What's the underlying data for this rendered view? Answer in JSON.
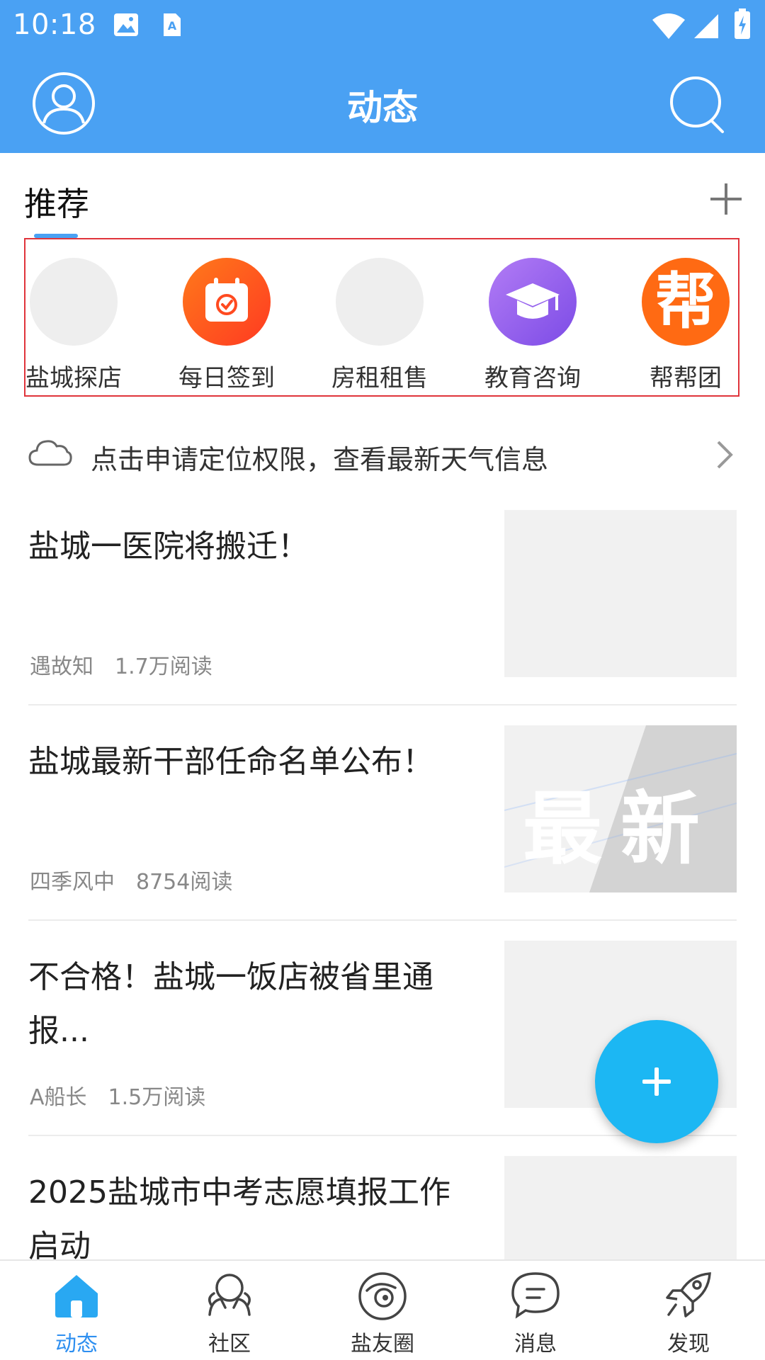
{
  "status_bar": {
    "time": "10:18"
  },
  "app_bar": {
    "title": "动态"
  },
  "tabs": {
    "active_tab": "推荐"
  },
  "recommend": [
    {
      "label": "盐城探店",
      "icon": "placeholder-icon"
    },
    {
      "label": "每日签到",
      "icon": "calendar-check-icon",
      "color": "#ff5a1f"
    },
    {
      "label": "房租租售",
      "icon": "placeholder-icon"
    },
    {
      "label": "教育咨询",
      "icon": "graduation-cap-icon",
      "color": "#9a5cf0"
    },
    {
      "label": "帮帮团",
      "icon": "bang-icon",
      "icon_text": "帮",
      "color": "#ff6a13"
    }
  ],
  "weather": {
    "text": "点击申请定位权限，查看最新天气信息"
  },
  "news": [
    {
      "title": "盐城一医院将搬迁！",
      "author": "遇故知",
      "reads": "1.7万阅读"
    },
    {
      "title": "盐城最新干部任命名单公布！",
      "author": "四季风中",
      "reads": "8754阅读",
      "thumb_text": "最新"
    },
    {
      "title": "不合格！盐城一饭店被省里通报...",
      "author": "A船长",
      "reads": "1.5万阅读"
    },
    {
      "title": "2025盐城市中考志愿填报工作启动"
    }
  ],
  "bottom_nav": [
    {
      "label": "动态",
      "icon": "home-icon",
      "active": true
    },
    {
      "label": "社区",
      "icon": "community-icon"
    },
    {
      "label": "盐友圈",
      "icon": "planet-icon"
    },
    {
      "label": "消息",
      "icon": "message-icon"
    },
    {
      "label": "发现",
      "icon": "rocket-icon"
    }
  ],
  "colors": {
    "primary": "#4aa1f3",
    "fab": "#1cb7f3",
    "highlight_border": "#e0343b"
  }
}
